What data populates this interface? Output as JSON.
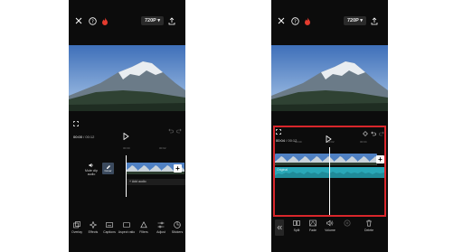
{
  "left": {
    "resolution": "720P",
    "time_current": "00:00",
    "time_total": "00:12",
    "ruler_labels": [
      "00:00",
      "00:02"
    ],
    "mute_label": "Mute clip audio",
    "cover_label": "Cover",
    "add_audio_label": "+ Add audio",
    "tools": [
      {
        "icon": "overlay-icon",
        "label": "Overlay"
      },
      {
        "icon": "effects-icon",
        "label": "Effects"
      },
      {
        "icon": "captions-icon",
        "label": "Captions"
      },
      {
        "icon": "aspect-ratio-icon",
        "label": "Aspect ratio"
      },
      {
        "icon": "filters-icon",
        "label": "Filters"
      },
      {
        "icon": "adjust-icon",
        "label": "Adjust"
      },
      {
        "icon": "stickers-icon",
        "label": "Stickers"
      }
    ]
  },
  "right": {
    "resolution": "720P",
    "time_current": "00:04",
    "time_total": "00:12",
    "ruler_labels": [
      "00:00",
      "00:02",
      "00:04"
    ],
    "audio_label": "Original",
    "tools": [
      {
        "icon": "split-icon",
        "label": "Split"
      },
      {
        "icon": "fade-icon",
        "label": "Fade"
      },
      {
        "icon": "volume-icon",
        "label": "Volume"
      },
      {
        "icon": "voice-effects-icon",
        "label": ""
      },
      {
        "icon": "delete-icon",
        "label": "Delete"
      }
    ]
  },
  "colors": {
    "app_background": "#0c0c0c",
    "highlight": "#d8262b",
    "audio_track": "#29a8b8",
    "flame": "#e33b2e"
  }
}
